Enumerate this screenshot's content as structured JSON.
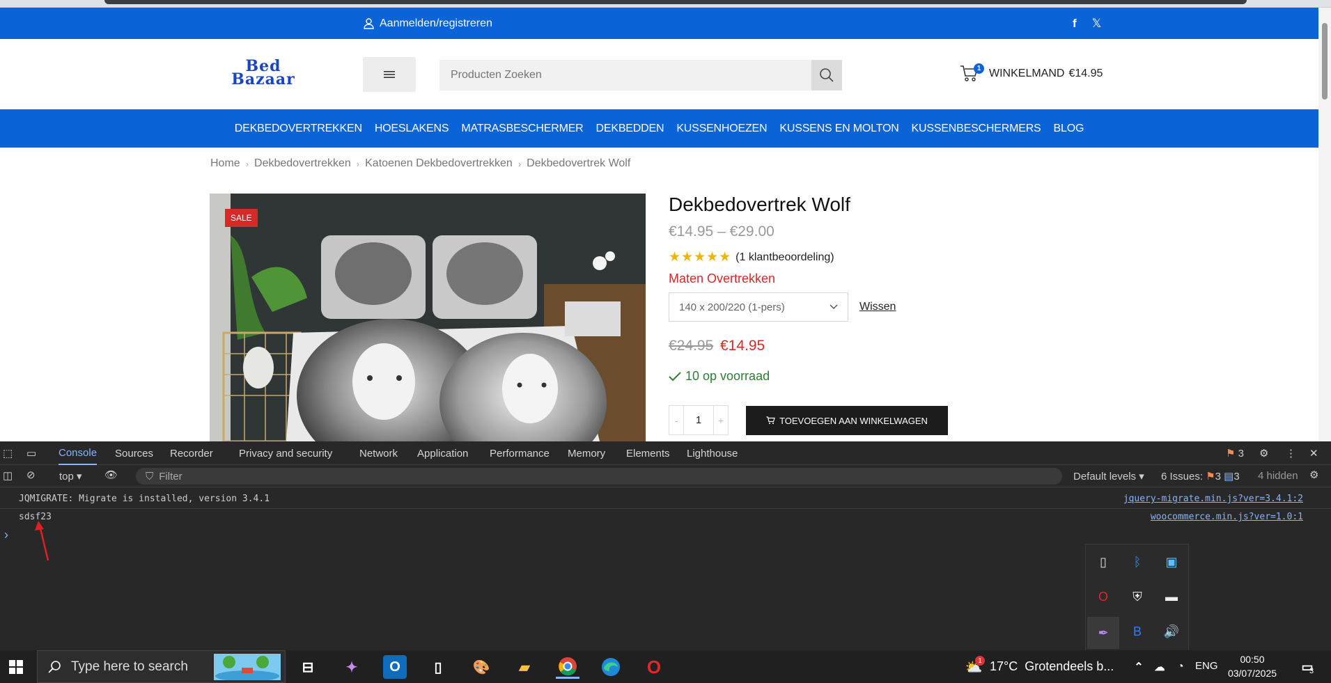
{
  "topbar": {
    "login_label": "Aanmelden/registreren"
  },
  "header": {
    "logo_line1": "Bed",
    "logo_line2": "Bazaar",
    "search_placeholder": "Producten Zoeken",
    "cart_count": "1",
    "cart_label": "WINKELMAND",
    "cart_total": "€14.95"
  },
  "nav": [
    "DEKBEDOVERTREKKEN",
    "HOESLAKENS",
    "MATRASBESCHERMER",
    "DEKBEDDEN",
    "KUSSENHOEZEN",
    "KUSSENS EN MOLTON",
    "KUSSENBESCHERMERS",
    "BLOG"
  ],
  "breadcrumb": [
    "Home",
    "Dekbedovertrekken",
    "Katoenen Dekbedovertrekken",
    "Dekbedovertrek Wolf"
  ],
  "product": {
    "sale_badge": "SALE",
    "title": "Dekbedovertrek Wolf",
    "price_range": "€14.95 – €29.00",
    "rating": 5,
    "rating_text": "(1 klantbeoordeling)",
    "attr_label": "Maten Overtrekken",
    "selected_size": "140 x 200/220 (1-pers)",
    "clear_label": "Wissen",
    "old_price": "€24.95",
    "new_price": "€14.95",
    "stock_text": "10 op voorraad",
    "qty_minus": "-",
    "qty_plus": "+",
    "quantity": "1",
    "add_to_cart": "TOEVOEGEN AAN WINKELWAGEN",
    "colors": {
      "sale": "#d42a2a",
      "stock": "#2e7d32",
      "brand": "#0b63d8"
    }
  },
  "devtools": {
    "tabs": [
      "Console",
      "Sources",
      "Recorder",
      "Privacy and security",
      "Network",
      "Application",
      "Performance",
      "Memory",
      "Elements",
      "Lighthouse"
    ],
    "active_tab": "Console",
    "issues_badge": "3",
    "context": "top",
    "filter_placeholder": "Filter",
    "levels": "Default levels",
    "issues_label": "6 Issues:",
    "issues_warn": "3",
    "issues_info": "3",
    "hidden": "4 hidden",
    "logs": [
      {
        "text": "JQMIGRATE: Migrate is installed, version 3.4.1",
        "source": "jquery-migrate.min.js?ver=3.4.1:2"
      },
      {
        "text": "sdsf23",
        "source": "woocommerce.min.js?ver=1.0:1"
      }
    ],
    "prompt": "›"
  },
  "tray_popup": [
    "usb-icon",
    "bluetooth-icon",
    "display-icon",
    "opera-icon",
    "security-icon",
    "battery-icon",
    "pen-icon",
    "app-b-icon",
    "speaker-icon"
  ],
  "taskbar": {
    "search_placeholder": "Type here to search",
    "weather_badge": "1",
    "temperature": "17°C",
    "weather": "Grotendeels b...",
    "language": "ENG",
    "time": "00:50",
    "date": "03/07/2025",
    "notifications": "3"
  }
}
